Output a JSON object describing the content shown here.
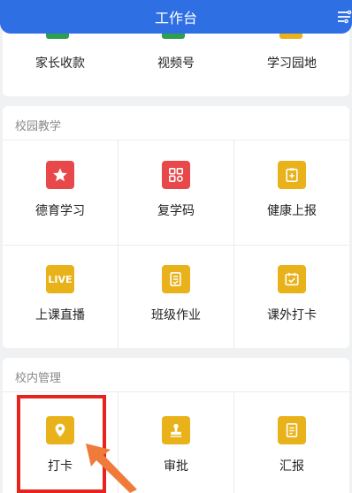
{
  "header": {
    "title": "工作台"
  },
  "top_partial": {
    "items": [
      {
        "label": "家长收款",
        "color": "#2e9e4f"
      },
      {
        "label": "视频号",
        "color": "#2e9e4f"
      },
      {
        "label": "学习园地",
        "color": "#e9b21a"
      }
    ]
  },
  "campus_teaching": {
    "title": "校园教学",
    "items": [
      {
        "label": "德育学习",
        "icon": "star-icon",
        "color": "#e8484a"
      },
      {
        "label": "复学码",
        "icon": "qr-code-icon",
        "color": "#e8484a"
      },
      {
        "label": "健康上报",
        "icon": "health-report-icon",
        "color": "#e9b21a"
      },
      {
        "label": "上课直播",
        "icon": "live-icon",
        "icon_text": "LIVE",
        "color": "#e9b21a"
      },
      {
        "label": "班级作业",
        "icon": "homework-icon",
        "color": "#e9b21a"
      },
      {
        "label": "课外打卡",
        "icon": "check-in-calendar-icon",
        "color": "#e9b21a"
      }
    ]
  },
  "campus_management": {
    "title": "校内管理",
    "items": [
      {
        "label": "打卡",
        "icon": "location-pin-icon",
        "color": "#e9b21a"
      },
      {
        "label": "审批",
        "icon": "stamp-icon",
        "color": "#e9b21a"
      },
      {
        "label": "汇报",
        "icon": "report-document-icon",
        "color": "#e9b21a"
      }
    ]
  },
  "annotation": {
    "highlight_color": "#e8231e",
    "arrow_color": "#f07a3a"
  }
}
